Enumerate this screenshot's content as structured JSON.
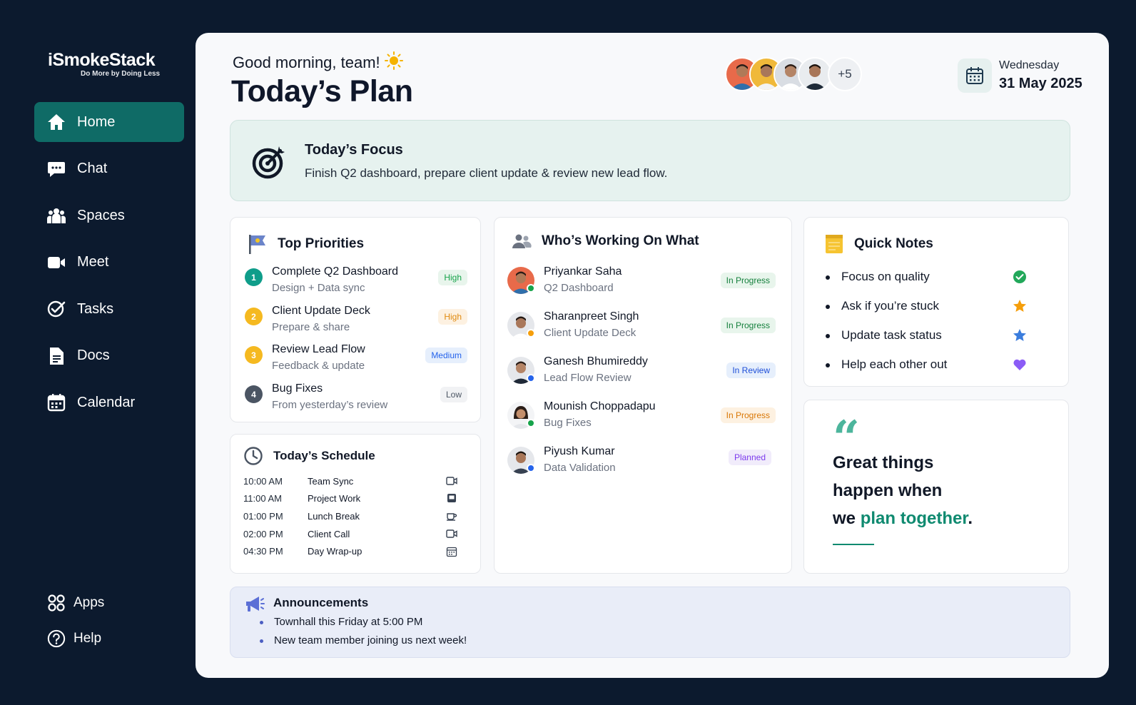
{
  "brand": {
    "name": "iSmokeStack",
    "tagline": "Do More by Doing Less"
  },
  "nav": {
    "items": [
      {
        "label": "Home",
        "icon": "home-icon",
        "active": true
      },
      {
        "label": "Chat",
        "icon": "chat-icon"
      },
      {
        "label": "Spaces",
        "icon": "people-icon"
      },
      {
        "label": "Meet",
        "icon": "video-icon"
      },
      {
        "label": "Tasks",
        "icon": "check-badge-icon"
      },
      {
        "label": "Docs",
        "icon": "document-icon"
      },
      {
        "label": "Calendar",
        "icon": "calendar-icon"
      }
    ],
    "bottom": [
      {
        "label": "Apps",
        "icon": "grid-icon"
      },
      {
        "label": "Help",
        "icon": "help-icon"
      }
    ]
  },
  "header": {
    "greeting": "Good morning, team!",
    "title": "Today’s Plan",
    "team_more": "+5",
    "date_day": "Wednesday",
    "date": "31 May 2025"
  },
  "focus": {
    "title": "Today’s Focus",
    "text": "Finish Q2 dashboard, prepare client update & review new lead flow."
  },
  "priorities": {
    "title": "Top Priorities",
    "items": [
      {
        "num": "1",
        "title": "Complete Q2 Dashboard",
        "sub": "Design + Data sync",
        "level": "High"
      },
      {
        "num": "2",
        "title": "Client Update Deck",
        "sub": "Prepare & share",
        "level": "High"
      },
      {
        "num": "3",
        "title": "Review Lead Flow",
        "sub": "Feedback & update",
        "level": "Medium"
      },
      {
        "num": "4",
        "title": "Bug Fixes",
        "sub": "From yesterday’s review",
        "level": "Low"
      }
    ]
  },
  "schedule": {
    "title": "Today’s Schedule",
    "items": [
      {
        "time": "10:00 AM",
        "label": "Team Sync",
        "icon": "video-icon"
      },
      {
        "time": "11:00 AM",
        "label": "Project Work",
        "icon": "laptop-icon"
      },
      {
        "time": "01:00 PM",
        "label": "Lunch Break",
        "icon": "coffee-icon"
      },
      {
        "time": "02:00 PM",
        "label": "Client Call",
        "icon": "video-icon"
      },
      {
        "time": "04:30 PM",
        "label": "Day Wrap-up",
        "icon": "calendar-icon"
      }
    ]
  },
  "working": {
    "title": "Who’s Working On What",
    "items": [
      {
        "name": "Priyankar Saha",
        "task": "Q2 Dashboard",
        "status": "In Progress"
      },
      {
        "name": "Sharanpreet Singh",
        "task": "Client Update Deck",
        "status": "In Progress"
      },
      {
        "name": "Ganesh Bhumireddy",
        "task": "Lead Flow Review",
        "status": "In Review"
      },
      {
        "name": "Mounish Choppadapu",
        "task": "Bug Fixes",
        "status": "In Progress"
      },
      {
        "name": "Piyush Kumar",
        "task": "Data Validation",
        "status": "Planned"
      }
    ]
  },
  "notes": {
    "title": "Quick Notes",
    "items": [
      {
        "text": "Focus on quality",
        "mark": "check-circle-icon"
      },
      {
        "text": "Ask if you’re stuck",
        "mark": "star-icon"
      },
      {
        "text": "Update task status",
        "mark": "star-icon"
      },
      {
        "text": "Help each other out",
        "mark": "heart-icon"
      }
    ]
  },
  "quote": {
    "line1": "Great things",
    "line2": "happen when",
    "line3_pre": "we ",
    "line3_accent": "plan together",
    "line3_post": "."
  },
  "announcements": {
    "title": "Announcements",
    "items": [
      "Townhall this Friday at 5:00 PM",
      "New team member joining us next week!"
    ]
  },
  "colors": {
    "sidebar_bg": "#0c1a2e",
    "active_nav": "#0f6b66",
    "accent_green": "#0f8a70",
    "high": "#16a34a",
    "medium": "#2563eb",
    "low": "#6b7280",
    "in_progress": "#15803d",
    "in_review": "#1d4ed8",
    "planned": "#7c3aed"
  }
}
